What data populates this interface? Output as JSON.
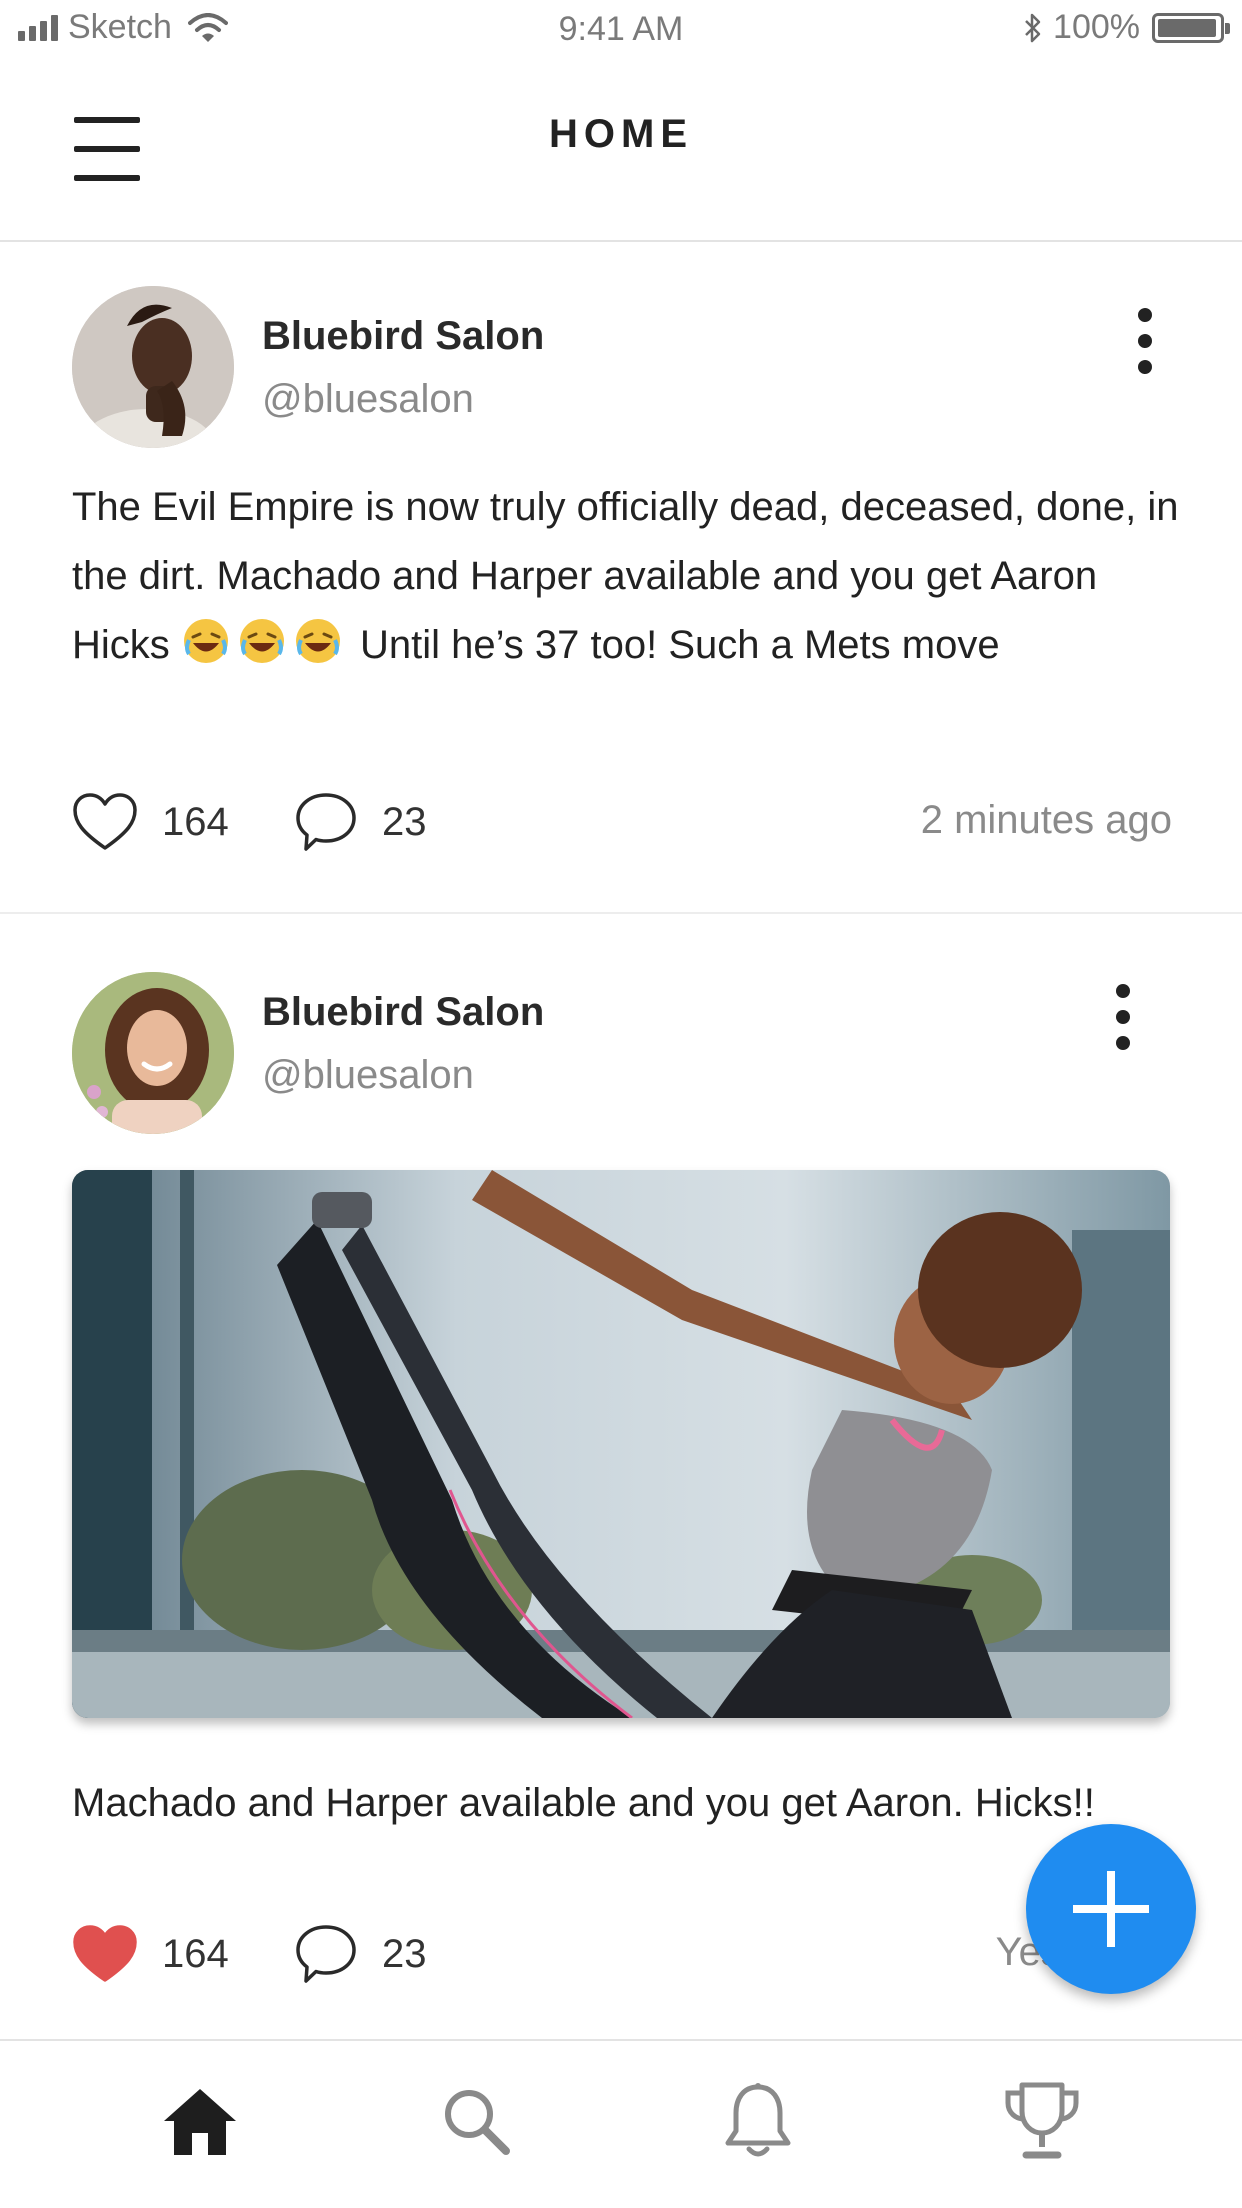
{
  "status_bar": {
    "carrier": "Sketch",
    "time": "9:41 AM",
    "battery": "100%",
    "icons": [
      "signal-icon",
      "wifi-icon",
      "bluetooth-icon",
      "battery-icon"
    ]
  },
  "header": {
    "title": "HOME",
    "menu_icon": "hamburger-icon"
  },
  "posts": [
    {
      "author": "Bluebird Salon",
      "handle": "@bluesalon",
      "text_before": "The Evil Empire is now truly officially dead, deceased, done, in the dirt. Machado and Harper available and you get Aaron Hicks ",
      "emojis": [
        "face-with-tears-of-joy",
        "face-with-tears-of-joy",
        "face-with-tears-of-joy"
      ],
      "text_after": " Until he’s 37 too! Such a Mets move",
      "likes": "164",
      "comments": "23",
      "liked": false,
      "time": "2 minutes ago"
    },
    {
      "author": "Bluebird Salon",
      "handle": "@bluesalon",
      "image": "woman-doing-v-sit-exercise-photo",
      "text": "Machado and Harper available and you get Aaron. Hicks!!",
      "likes": "164",
      "comments": "23",
      "liked": true,
      "time": "Yesterday"
    }
  ],
  "fab": {
    "icon": "plus-icon"
  },
  "tab_bar": {
    "items": [
      {
        "icon": "home-icon",
        "active": true
      },
      {
        "icon": "search-icon",
        "active": false
      },
      {
        "icon": "bell-icon",
        "active": false
      },
      {
        "icon": "trophy-icon",
        "active": false
      }
    ]
  },
  "colors": {
    "accent": "#1f8cf0",
    "liked_heart": "#e0504f",
    "text_primary": "#222222",
    "text_secondary": "#8a8a8a"
  }
}
